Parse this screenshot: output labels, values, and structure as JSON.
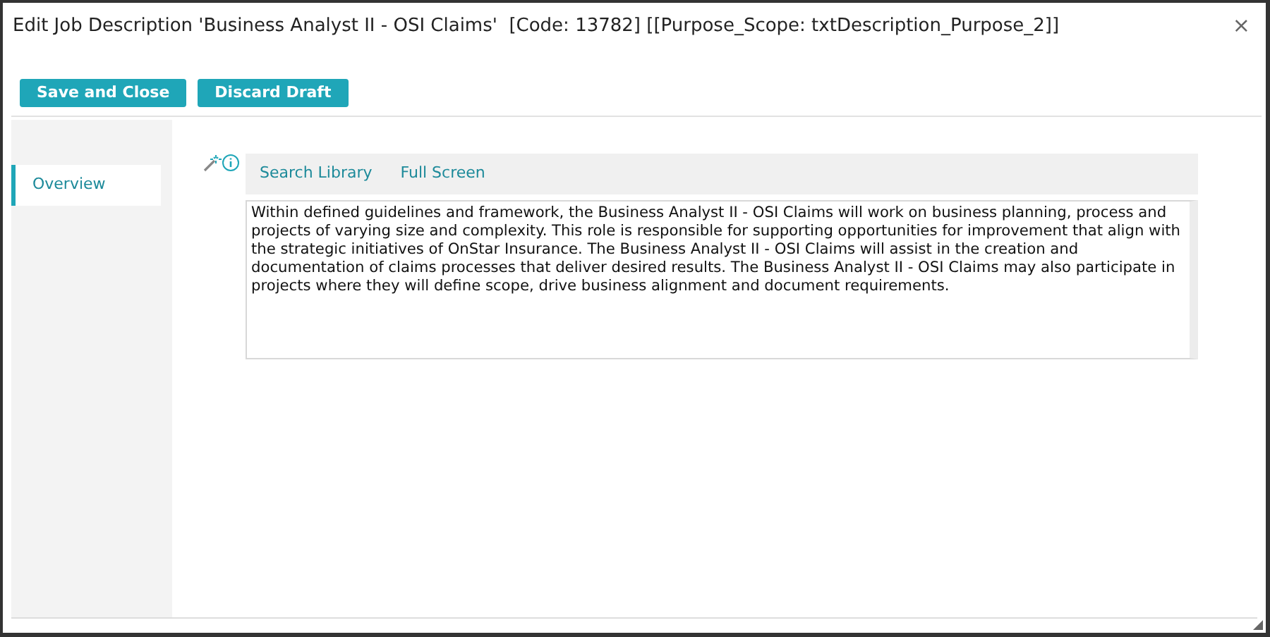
{
  "window": {
    "title": "Edit Job Description 'Business Analyst II - OSI Claims'  [Code: 13782] [[Purpose_Scope: txtDescription_Purpose_2]]",
    "close": "×"
  },
  "buttons": [
    "Save and Close",
    "Discard Draft"
  ],
  "sidebar": {
    "items": [
      {
        "label": "Overview",
        "selected": true
      }
    ]
  },
  "editor": {
    "toolbar": [
      "Search Library",
      "Full Screen"
    ],
    "text": "Within defined guidelines and framework, the Business Analyst II - OSI Claims will work on business planning, process and projects of varying size and complexity.  This role is responsible for supporting opportunities for improvement that align with the strategic initiatives of OnStar Insurance.  The Business Analyst II - OSI Claims will assist in the creation and documentation of claims processes that deliver desired results.  The Business Analyst II - OSI Claims may also participate in projects where they will define scope, drive business alignment and document requirements."
  }
}
